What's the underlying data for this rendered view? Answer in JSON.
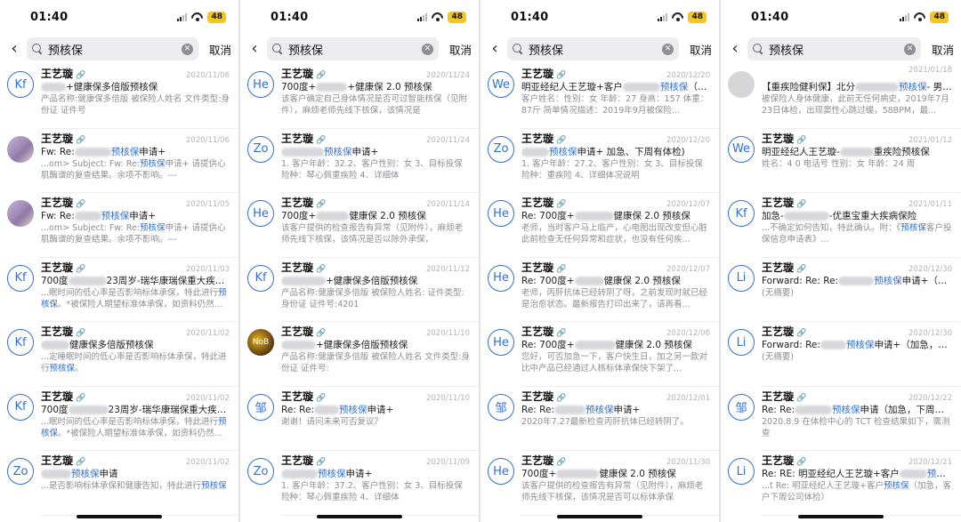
{
  "panels": [
    {
      "status": {
        "time": "01:40",
        "battery": "48"
      },
      "search": {
        "query": "预核保",
        "cancel": "取消"
      },
      "items": [
        {
          "avatar": "Kf",
          "sender": "王艺璇",
          "date": "2020/11/06",
          "subject_a": "",
          "subject_kw": "",
          "subject_b": "+健康保多倍版预核保",
          "preview": "产品名称:健康保多倍版 被保险人姓名 文件类型:身份证 证件号"
        },
        {
          "avatar": "",
          "avatar_style": "photo",
          "sender": "王艺璇",
          "date": "2020/11/06",
          "subject_a": "Fw: Re:",
          "subject_kw": "预核保",
          "subject_b": "申请+",
          "preview": "...om> Subject: Fw: Re:预核保申请+ 请提供心肌酶谱的复查结果。余项不影响。---"
        },
        {
          "avatar": "",
          "avatar_style": "photo",
          "sender": "王艺璇",
          "date": "2020/11/05",
          "subject_a": "Fw: Re:",
          "subject_kw": "预核保",
          "subject_b": "申请+",
          "preview": "...om> Subject: Fw: Re:预核保申请+ 请提供心肌酶谱的复查结果。余项不影响。---"
        },
        {
          "avatar": "Kf",
          "sender": "王艺璇",
          "date": "2020/11/03",
          "subject_a": "700度",
          "subject_kw": "",
          "subject_b": "23周岁-瑞华康瑞保重大疾病保险",
          "preview": "...眠时间的低心率是否影响标体承保，特此进行预核保。*被保险人期望标准体承保，如资料仍然..."
        },
        {
          "avatar": "Kf",
          "sender": "王艺璇",
          "date": "2020/11/02",
          "subject_a": "",
          "subject_kw": "",
          "subject_b": "健康保多倍版预核保",
          "preview": "...定睡眠时间的低心率是否影响标体承保，特此进行预核保。"
        },
        {
          "avatar": "Kf",
          "sender": "王艺璇",
          "date": "2020/11/02",
          "subject_a": "700度",
          "subject_kw": "",
          "subject_b": "23周岁-瑞华康瑞保重大疾病保险",
          "preview": "...眠时间的低心率是否影响标体承保，特此进行预核保。*被保险人期望标准体承保，如资料仍然..."
        },
        {
          "avatar": "Zo",
          "sender": "王艺璇",
          "date": "2020/11/02",
          "subject_a": "",
          "subject_kw": "预核保",
          "subject_b": "申请",
          "preview": "...是否影响标体承保和健康告知，特此进行预核保"
        }
      ]
    },
    {
      "status": {
        "time": "01:40",
        "battery": "48"
      },
      "search": {
        "query": "预核保",
        "cancel": "取消"
      },
      "items": [
        {
          "avatar": "He",
          "sender": "王艺璇",
          "date": "2020/11/24",
          "subject_a": "700度+",
          "subject_kw": "",
          "subject_b": "+健康保 2.0 预核保",
          "preview": "该客户确定自己身体情况是否可过智能核保（见附件），麻烦老师先线下核保，该情况是"
        },
        {
          "avatar": "Zo",
          "sender": "王艺璇",
          "date": "2020/11/24",
          "subject_a": "",
          "subject_kw": "预核保",
          "subject_b": "申请+",
          "preview": "1. 客户年龄：32.2、客户性别：女 3、目标投保险种：琴心佩重疾险 4、详细体"
        },
        {
          "avatar": "He",
          "sender": "王艺璇",
          "date": "2020/11/14",
          "subject_a": "700度+",
          "subject_kw": "",
          "subject_b": "健康保 2.0 预核保",
          "preview": "该客户提供的检查报告有异常（见附件），麻烦老师先线下核保，该情况是否以除外承保，"
        },
        {
          "avatar": "Kf",
          "sender": "王艺璇",
          "date": "2020/11/12",
          "subject_a": "",
          "subject_kw": "",
          "subject_b": "+健康保多倍版预核保",
          "preview": "产品名称:健康保多倍版 被保险人姓名: 证件类型:身份证 证件号:4201"
        },
        {
          "avatar": "NoB",
          "avatar_style": "dark",
          "sender": "王艺璇",
          "date": "2020/11/10",
          "subject_a": "",
          "subject_kw": "",
          "subject_b": "+健康保多倍版预核保",
          "preview": "产品名称:健康保多倍版 被保险人姓名 文件类型:身份证 证件号:"
        },
        {
          "avatar": "邹",
          "sender": "王艺璇",
          "date": "2020/11/10",
          "subject_a": "Re: Re:",
          "subject_kw": "预核保",
          "subject_b": "申请+",
          "preview": "谢谢！请问未来可否复议？"
        },
        {
          "avatar": "Zo",
          "sender": "王艺璇",
          "date": "2020/11/09",
          "subject_a": "",
          "subject_kw": "预核保",
          "subject_b": "申请+",
          "preview": "1. 客户年龄：37.2、客户性别：女 3、目标投保险种：琴心佩重疾险 4、详细体"
        }
      ]
    },
    {
      "status": {
        "time": "01:40",
        "battery": "48"
      },
      "search": {
        "query": "预核保",
        "cancel": "取消"
      },
      "items": [
        {
          "avatar": "We",
          "sender": "王艺璇",
          "date": "2020/12/20",
          "subject_a": "明亚经纪人王艺璇+客户",
          "subject_kw": "预核保",
          "subject_b": "（加急，客...",
          "preview": "客户姓名：性别：女 年龄：27 身高：157 体重：87斤 简单情况描述：2019年9月被保险..."
        },
        {
          "avatar": "Zo",
          "sender": "王艺璇",
          "date": "2020/12/20",
          "subject_a": "",
          "subject_kw": "预核保",
          "subject_b": "申请+ 加急、下周有体检)",
          "preview": "1. 客户年龄：27.2、客户性别：女 3、目标投保险种：重疾险 4、详细体况说明"
        },
        {
          "avatar": "He",
          "sender": "王艺璇",
          "date": "2020/12/07",
          "subject_a": "Re: 700度+",
          "subject_kw": "",
          "subject_b": "健康保 2.0 预核保",
          "preview": "老师，当时客户马上临产，心电图出现改变但心脏此前检查无任何异常和症状，也没有任何疾..."
        },
        {
          "avatar": "He",
          "sender": "王艺璇",
          "date": "2020/12/07",
          "subject_a": "Re: 700度+",
          "subject_kw": "",
          "subject_b": "健康保 2.0 预核保",
          "preview": "老师，丙肝抗体已经转阴了呀，之前发现时就已经是治愈状态。最新报告打印出来了，请再看..."
        },
        {
          "avatar": "He",
          "sender": "王艺璇",
          "date": "2020/12/06",
          "subject_a": "Re: 700度+",
          "subject_kw": "",
          "subject_b": "健康保 2.0 预核保",
          "preview": "您好，可否加急一下，客户快生日，加之另一款对比中产品已经通过人核标体承保快下架了..."
        },
        {
          "avatar": "邹",
          "sender": "王艺璇",
          "date": "2020/12/01",
          "subject_a": "Re: Re:",
          "subject_kw": "预核保",
          "subject_b": "申请+",
          "preview": "2020年7.27最新检查丙肝抗体已经转阴了。"
        },
        {
          "avatar": "He",
          "sender": "王艺璇",
          "date": "2020/11/30",
          "subject_a": "700度+",
          "subject_kw": "",
          "subject_b": "健康保 2.0 预核保",
          "preview": "该客户提供的检查报告有异常（见附件），麻烦老师先线下核保，该情况是否可以标体承保"
        }
      ]
    },
    {
      "status": {
        "time": "01:40",
        "battery": "48"
      },
      "search": {
        "query": "预核保",
        "cancel": "取消"
      },
      "items": [
        {
          "avatar": "",
          "avatar_style": "grey",
          "sender": "",
          "date": "2021/01/18",
          "subject_a": "【重疾险健利保】北分",
          "subject_kw": "预核保",
          "subject_b": "- 男、2...",
          "preview": "被保险人身体健康，此前无任何病史，2019年7月23日体检，出现窦性心跳过缓，58BPM，最..."
        },
        {
          "avatar": "We",
          "sender": "王艺璇",
          "date": "2021/01/12",
          "subject_a": "明亚经纪人王艺璇-",
          "subject_kw": "",
          "subject_b": "重疾险预核保",
          "preview": "姓名：4 0 电话号 性别：女 年龄：24 周"
        },
        {
          "avatar": "Kf",
          "sender": "王艺璇",
          "date": "2021/01/11",
          "subject_a": "加急-",
          "subject_kw": "",
          "subject_b": "-优惠宝重大疾病保险",
          "preview": "...不确定如何告知，特此确认。附：《预核保客户投保信息申请表》..."
        },
        {
          "avatar": "Li",
          "sender": "王艺璇",
          "date": "2020/12/30",
          "subject_a": "Forward: Re: Re:",
          "subject_kw": "预核保",
          "subject_b": "申请+（加急，下...",
          "preview": "(无摘要)"
        },
        {
          "avatar": "Li",
          "sender": "王艺璇",
          "date": "2020/12/30",
          "subject_a": "Forward: Re:",
          "subject_kw": "预核保",
          "subject_b": "申请+（加急，下周有...",
          "preview": "(无摘要)"
        },
        {
          "avatar": "邹",
          "sender": "王艺璇",
          "date": "2020/12/22",
          "subject_a": "Re: Re:",
          "subject_kw": "预核保",
          "subject_b": "申请（加急，下周有体检）",
          "preview": "2020.8.9 在体检中心的 TCT 检查结果如下，需测查"
        },
        {
          "avatar": "Li",
          "sender": "王艺璇",
          "date": "2020/12/21",
          "subject_a": "Re: RE: 明亚经纪人王艺璇+客户",
          "subject_kw": "预核保",
          "subject_b": "",
          "preview": "...t Re: 明亚经纪人王艺璇+客户预核保（加急，客户下周公司体检）"
        }
      ]
    }
  ]
}
